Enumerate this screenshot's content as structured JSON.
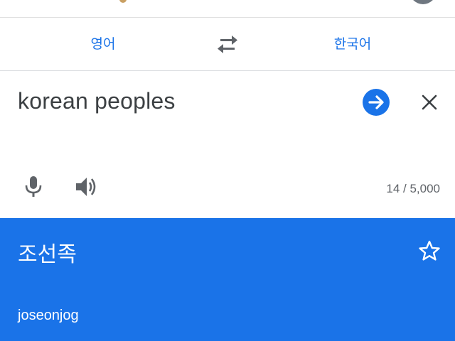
{
  "languages": {
    "source": "영어",
    "target": "한국어"
  },
  "input": {
    "text": "korean peoples",
    "char_count": "14 / 5,000"
  },
  "result": {
    "translation": "조선족",
    "romanization": "joseonjog"
  },
  "icons": {
    "swap": "swap-arrows-icon",
    "go": "arrow-right-icon",
    "clear": "close-icon",
    "mic": "microphone-icon",
    "speaker": "speaker-icon",
    "star": "star-outline-icon"
  },
  "colors": {
    "accent": "#1a73e8",
    "text": "#3c4043",
    "muted": "#5f6368",
    "result_text": "#ffffff"
  }
}
